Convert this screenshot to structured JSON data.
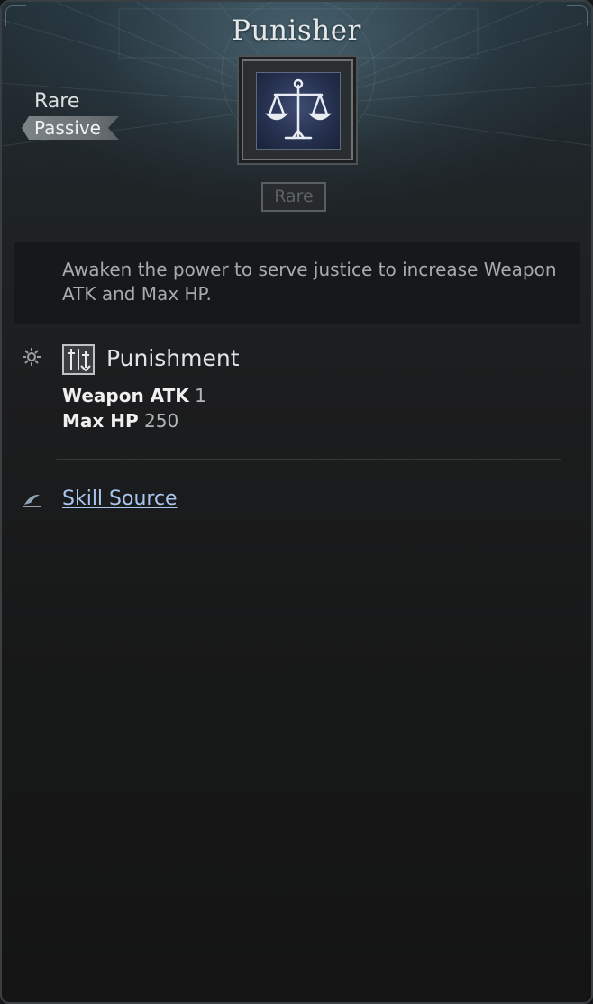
{
  "skill": {
    "title": "Punisher",
    "rarity": "Rare",
    "type": "Passive",
    "rarity_badge": "Rare",
    "description": "Awaken the power to serve justice to increase Weapon ATK and Max HP.",
    "icon": "scales-of-justice-icon"
  },
  "effect": {
    "name": "Punishment",
    "icon": "punishment-effect-icon",
    "stats": [
      {
        "label": "Weapon ATK",
        "value": "1"
      },
      {
        "label": "Max HP",
        "value": "250"
      }
    ]
  },
  "source": {
    "label": "Skill Source",
    "icon": "quill-icon"
  },
  "colors": {
    "link": "#a9c6ef",
    "title": "#e4e8ea",
    "icon_bg": "#25304e"
  }
}
